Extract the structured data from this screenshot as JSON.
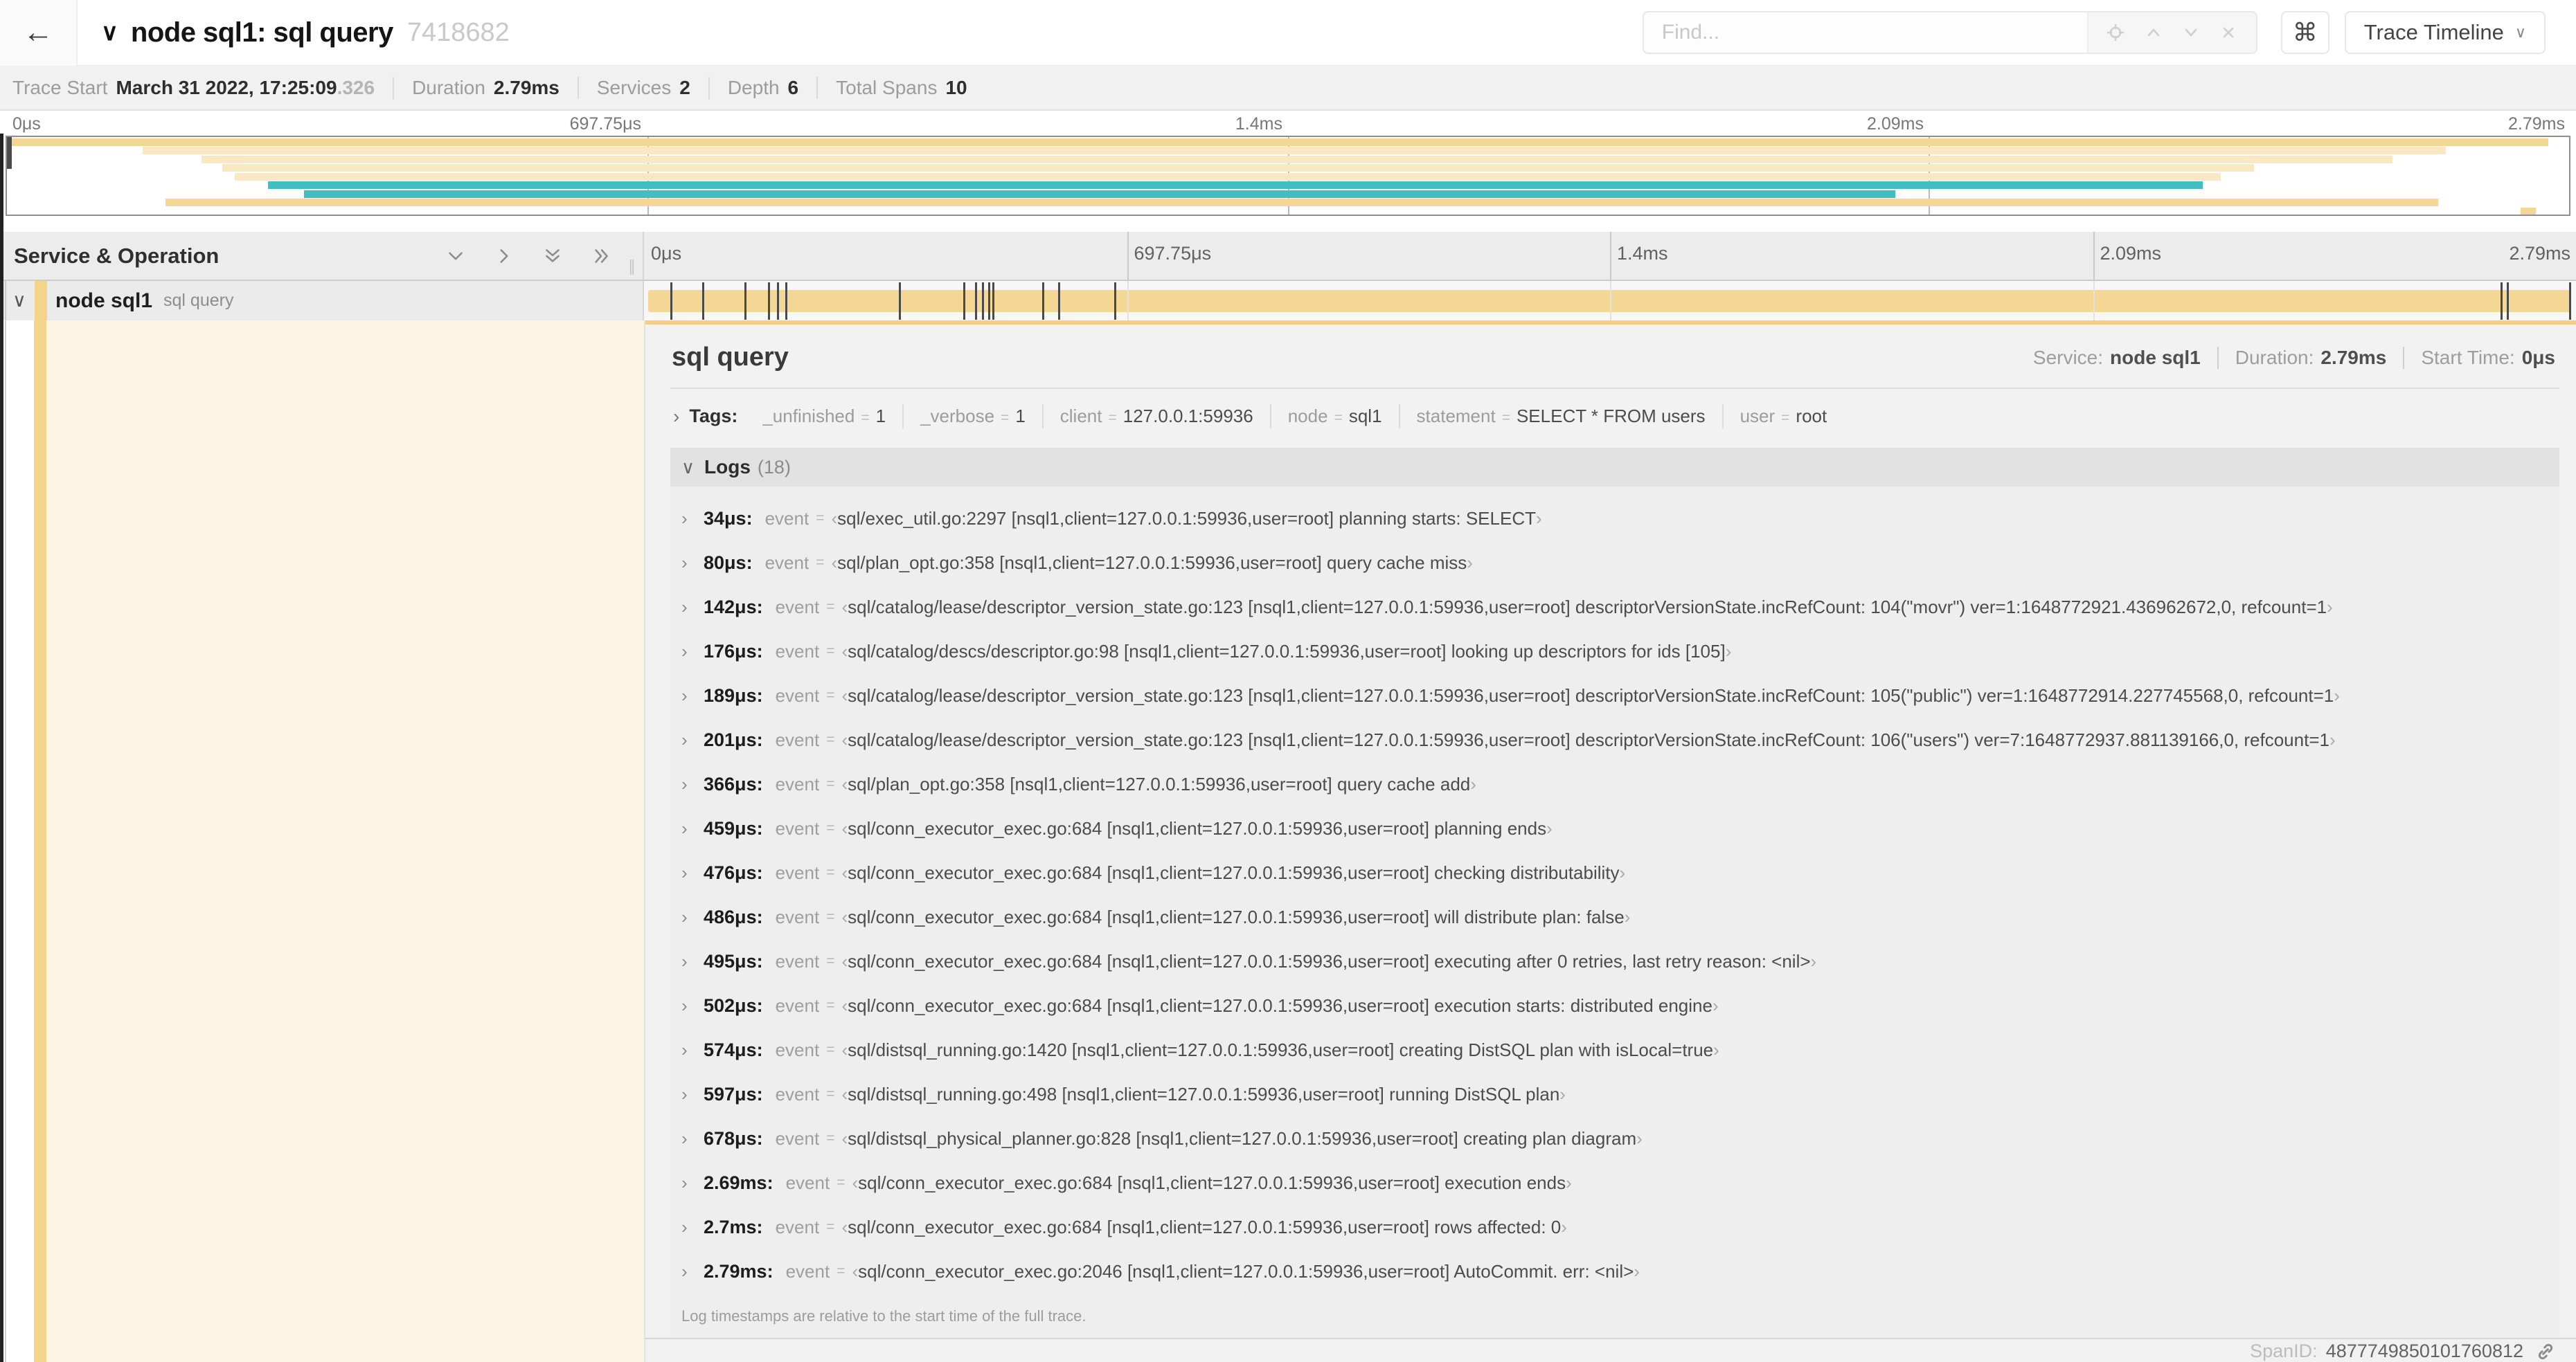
{
  "colors": {
    "tan": "#F5D795",
    "tan_light": "#FAE8C3",
    "teal": "#3FBFBF",
    "cream": "#FDF5E3",
    "stripe": "#F4D48A",
    "accent": "#F3CF86",
    "marker": "#4a4a4a"
  },
  "topbar": {
    "back_icon": "←",
    "collapse_icon": "∨",
    "title": "node sql1: sql query",
    "trace_id": "7418682",
    "find_placeholder": "Find...",
    "shortcut_icon": "⌘",
    "view_button_label": "Trace Timeline",
    "view_button_chevron": "∨"
  },
  "summary": {
    "items": [
      {
        "label": "Trace Start",
        "value": "March 31 2022, 17:25:09",
        "suffix": ".326"
      },
      {
        "label": "Duration",
        "value": "2.79ms"
      },
      {
        "label": "Services",
        "value": "2"
      },
      {
        "label": "Depth",
        "value": "6"
      },
      {
        "label": "Total Spans",
        "value": "10"
      }
    ]
  },
  "ruler": {
    "ticks": [
      {
        "pct": 0,
        "label": "0μs"
      },
      {
        "pct": 25,
        "label": "697.75μs"
      },
      {
        "pct": 50,
        "label": "1.4ms"
      },
      {
        "pct": 75,
        "label": "2.09ms"
      },
      {
        "pct": 100,
        "label": "2.79ms"
      }
    ]
  },
  "minimap": {
    "rows": [
      {
        "start": 0.2,
        "end": 99.2,
        "color": "#F5D795"
      },
      {
        "start": 5.3,
        "end": 95.2,
        "color": "#FAE8C3"
      },
      {
        "start": 7.6,
        "end": 93.1,
        "color": "#FAE8C3"
      },
      {
        "start": 8.4,
        "end": 87.7,
        "color": "#FAE8C3"
      },
      {
        "start": 8.9,
        "end": 86.4,
        "color": "#FAE8C3"
      },
      {
        "start": 10.2,
        "end": 85.7,
        "color": "#3FBFBF"
      },
      {
        "start": 11.6,
        "end": 73.7,
        "color": "#3FBFBF"
      },
      {
        "start": 6.2,
        "end": 94.9,
        "color": "#F5D795"
      },
      {
        "start": 98.1,
        "end": 98.7,
        "color": "#F5D795"
      }
    ]
  },
  "grid": {
    "left_header": "Service & Operation",
    "resizer_glyph": "∥"
  },
  "span_row": {
    "chevron": "∨",
    "service": "node sql1",
    "operation": "sql query"
  },
  "trace": {
    "total_us": 2790
  },
  "detail": {
    "title": "sql query",
    "meta": [
      {
        "label": "Service:",
        "value": "node sql1"
      },
      {
        "label": "Duration:",
        "value": "2.79ms"
      },
      {
        "label": "Start Time:",
        "value": "0μs"
      }
    ],
    "tags_chevron": "›",
    "tags_label": "Tags:",
    "tags": [
      {
        "key": "_unfinished",
        "value": "1"
      },
      {
        "key": "_verbose",
        "value": "1"
      },
      {
        "key": "client",
        "value": "127.0.0.1:59936"
      },
      {
        "key": "node",
        "value": "sql1"
      },
      {
        "key": "statement",
        "value": "SELECT * FROM users"
      },
      {
        "key": "user",
        "value": "root"
      }
    ],
    "logs_chevron": "∨",
    "logs_label": "Logs",
    "logs_count": "(18)",
    "log_field_key": "event",
    "logs": [
      {
        "t": "34μs:",
        "t_us": 34,
        "msg": "sql/exec_util.go:2297 [nsql1,client=127.0.0.1:59936,user=root] planning starts: SELECT"
      },
      {
        "t": "80μs:",
        "t_us": 80,
        "msg": "sql/plan_opt.go:358 [nsql1,client=127.0.0.1:59936,user=root] query cache miss"
      },
      {
        "t": "142μs:",
        "t_us": 142,
        "msg": "sql/catalog/lease/descriptor_version_state.go:123 [nsql1,client=127.0.0.1:59936,user=root] descriptorVersionState.incRefCount: 104(\"movr\") ver=1:1648772921.436962672,0, refcount=1"
      },
      {
        "t": "176μs:",
        "t_us": 176,
        "msg": "sql/catalog/descs/descriptor.go:98 [nsql1,client=127.0.0.1:59936,user=root] looking up descriptors for ids [105]"
      },
      {
        "t": "189μs:",
        "t_us": 189,
        "msg": "sql/catalog/lease/descriptor_version_state.go:123 [nsql1,client=127.0.0.1:59936,user=root] descriptorVersionState.incRefCount: 105(\"public\") ver=1:1648772914.227745568,0, refcount=1"
      },
      {
        "t": "201μs:",
        "t_us": 201,
        "msg": "sql/catalog/lease/descriptor_version_state.go:123 [nsql1,client=127.0.0.1:59936,user=root] descriptorVersionState.incRefCount: 106(\"users\") ver=7:1648772937.881139166,0, refcount=1"
      },
      {
        "t": "366μs:",
        "t_us": 366,
        "msg": "sql/plan_opt.go:358 [nsql1,client=127.0.0.1:59936,user=root] query cache add"
      },
      {
        "t": "459μs:",
        "t_us": 459,
        "msg": "sql/conn_executor_exec.go:684 [nsql1,client=127.0.0.1:59936,user=root] planning ends"
      },
      {
        "t": "476μs:",
        "t_us": 476,
        "msg": "sql/conn_executor_exec.go:684 [nsql1,client=127.0.0.1:59936,user=root] checking distributability"
      },
      {
        "t": "486μs:",
        "t_us": 486,
        "msg": "sql/conn_executor_exec.go:684 [nsql1,client=127.0.0.1:59936,user=root] will distribute plan: false"
      },
      {
        "t": "495μs:",
        "t_us": 495,
        "msg": "sql/conn_executor_exec.go:684 [nsql1,client=127.0.0.1:59936,user=root] executing after 0 retries, last retry reason: <nil>"
      },
      {
        "t": "502μs:",
        "t_us": 502,
        "msg": "sql/conn_executor_exec.go:684 [nsql1,client=127.0.0.1:59936,user=root] execution starts: distributed engine"
      },
      {
        "t": "574μs:",
        "t_us": 574,
        "msg": "sql/distsql_running.go:1420 [nsql1,client=127.0.0.1:59936,user=root] creating DistSQL plan with isLocal=true"
      },
      {
        "t": "597μs:",
        "t_us": 597,
        "msg": "sql/distsql_running.go:498 [nsql1,client=127.0.0.1:59936,user=root] running DistSQL plan"
      },
      {
        "t": "678μs:",
        "t_us": 678,
        "msg": "sql/distsql_physical_planner.go:828 [nsql1,client=127.0.0.1:59936,user=root] creating plan diagram"
      },
      {
        "t": "2.69ms:",
        "t_us": 2690,
        "msg": "sql/conn_executor_exec.go:684 [nsql1,client=127.0.0.1:59936,user=root] execution ends"
      },
      {
        "t": "2.7ms:",
        "t_us": 2700,
        "msg": "sql/conn_executor_exec.go:684 [nsql1,client=127.0.0.1:59936,user=root] rows affected: 0"
      },
      {
        "t": "2.79ms:",
        "t_us": 2790,
        "msg": "sql/conn_executor_exec.go:2046 [nsql1,client=127.0.0.1:59936,user=root] AutoCommit. err: <nil>"
      }
    ],
    "logs_note": "Log timestamps are relative to the start time of the full trace.",
    "span_id_label": "SpanID:",
    "span_id": "4877749850101760812"
  }
}
